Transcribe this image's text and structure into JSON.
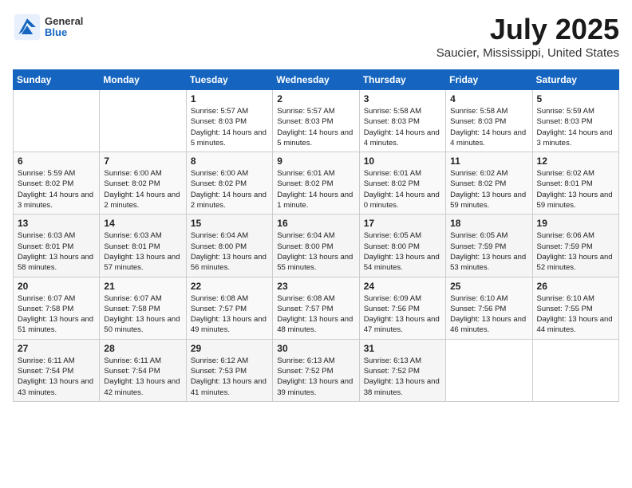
{
  "header": {
    "logo_general": "General",
    "logo_blue": "Blue",
    "title": "July 2025",
    "location": "Saucier, Mississippi, United States"
  },
  "weekdays": [
    "Sunday",
    "Monday",
    "Tuesday",
    "Wednesday",
    "Thursday",
    "Friday",
    "Saturday"
  ],
  "weeks": [
    [
      {
        "day": "",
        "info": ""
      },
      {
        "day": "",
        "info": ""
      },
      {
        "day": "1",
        "info": "Sunrise: 5:57 AM\nSunset: 8:03 PM\nDaylight: 14 hours and 5 minutes."
      },
      {
        "day": "2",
        "info": "Sunrise: 5:57 AM\nSunset: 8:03 PM\nDaylight: 14 hours and 5 minutes."
      },
      {
        "day": "3",
        "info": "Sunrise: 5:58 AM\nSunset: 8:03 PM\nDaylight: 14 hours and 4 minutes."
      },
      {
        "day": "4",
        "info": "Sunrise: 5:58 AM\nSunset: 8:03 PM\nDaylight: 14 hours and 4 minutes."
      },
      {
        "day": "5",
        "info": "Sunrise: 5:59 AM\nSunset: 8:03 PM\nDaylight: 14 hours and 3 minutes."
      }
    ],
    [
      {
        "day": "6",
        "info": "Sunrise: 5:59 AM\nSunset: 8:02 PM\nDaylight: 14 hours and 3 minutes."
      },
      {
        "day": "7",
        "info": "Sunrise: 6:00 AM\nSunset: 8:02 PM\nDaylight: 14 hours and 2 minutes."
      },
      {
        "day": "8",
        "info": "Sunrise: 6:00 AM\nSunset: 8:02 PM\nDaylight: 14 hours and 2 minutes."
      },
      {
        "day": "9",
        "info": "Sunrise: 6:01 AM\nSunset: 8:02 PM\nDaylight: 14 hours and 1 minute."
      },
      {
        "day": "10",
        "info": "Sunrise: 6:01 AM\nSunset: 8:02 PM\nDaylight: 14 hours and 0 minutes."
      },
      {
        "day": "11",
        "info": "Sunrise: 6:02 AM\nSunset: 8:02 PM\nDaylight: 13 hours and 59 minutes."
      },
      {
        "day": "12",
        "info": "Sunrise: 6:02 AM\nSunset: 8:01 PM\nDaylight: 13 hours and 59 minutes."
      }
    ],
    [
      {
        "day": "13",
        "info": "Sunrise: 6:03 AM\nSunset: 8:01 PM\nDaylight: 13 hours and 58 minutes."
      },
      {
        "day": "14",
        "info": "Sunrise: 6:03 AM\nSunset: 8:01 PM\nDaylight: 13 hours and 57 minutes."
      },
      {
        "day": "15",
        "info": "Sunrise: 6:04 AM\nSunset: 8:00 PM\nDaylight: 13 hours and 56 minutes."
      },
      {
        "day": "16",
        "info": "Sunrise: 6:04 AM\nSunset: 8:00 PM\nDaylight: 13 hours and 55 minutes."
      },
      {
        "day": "17",
        "info": "Sunrise: 6:05 AM\nSunset: 8:00 PM\nDaylight: 13 hours and 54 minutes."
      },
      {
        "day": "18",
        "info": "Sunrise: 6:05 AM\nSunset: 7:59 PM\nDaylight: 13 hours and 53 minutes."
      },
      {
        "day": "19",
        "info": "Sunrise: 6:06 AM\nSunset: 7:59 PM\nDaylight: 13 hours and 52 minutes."
      }
    ],
    [
      {
        "day": "20",
        "info": "Sunrise: 6:07 AM\nSunset: 7:58 PM\nDaylight: 13 hours and 51 minutes."
      },
      {
        "day": "21",
        "info": "Sunrise: 6:07 AM\nSunset: 7:58 PM\nDaylight: 13 hours and 50 minutes."
      },
      {
        "day": "22",
        "info": "Sunrise: 6:08 AM\nSunset: 7:57 PM\nDaylight: 13 hours and 49 minutes."
      },
      {
        "day": "23",
        "info": "Sunrise: 6:08 AM\nSunset: 7:57 PM\nDaylight: 13 hours and 48 minutes."
      },
      {
        "day": "24",
        "info": "Sunrise: 6:09 AM\nSunset: 7:56 PM\nDaylight: 13 hours and 47 minutes."
      },
      {
        "day": "25",
        "info": "Sunrise: 6:10 AM\nSunset: 7:56 PM\nDaylight: 13 hours and 46 minutes."
      },
      {
        "day": "26",
        "info": "Sunrise: 6:10 AM\nSunset: 7:55 PM\nDaylight: 13 hours and 44 minutes."
      }
    ],
    [
      {
        "day": "27",
        "info": "Sunrise: 6:11 AM\nSunset: 7:54 PM\nDaylight: 13 hours and 43 minutes."
      },
      {
        "day": "28",
        "info": "Sunrise: 6:11 AM\nSunset: 7:54 PM\nDaylight: 13 hours and 42 minutes."
      },
      {
        "day": "29",
        "info": "Sunrise: 6:12 AM\nSunset: 7:53 PM\nDaylight: 13 hours and 41 minutes."
      },
      {
        "day": "30",
        "info": "Sunrise: 6:13 AM\nSunset: 7:52 PM\nDaylight: 13 hours and 39 minutes."
      },
      {
        "day": "31",
        "info": "Sunrise: 6:13 AM\nSunset: 7:52 PM\nDaylight: 13 hours and 38 minutes."
      },
      {
        "day": "",
        "info": ""
      },
      {
        "day": "",
        "info": ""
      }
    ]
  ]
}
